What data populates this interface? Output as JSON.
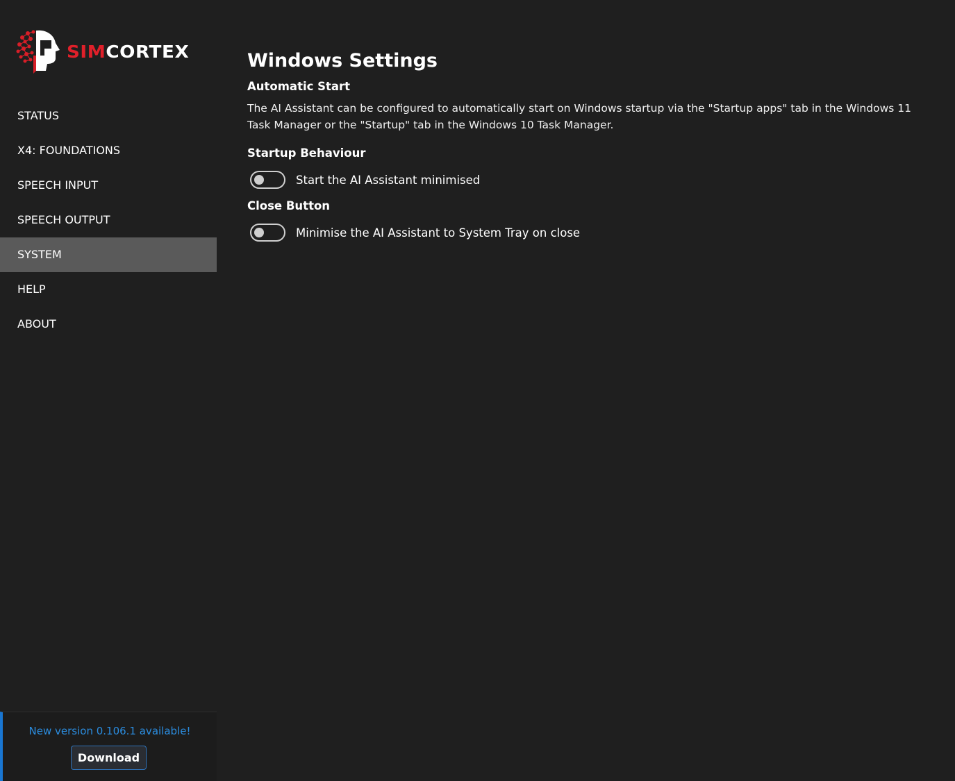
{
  "brand": {
    "part1": "SIM",
    "part2": "CORTEX",
    "accent_color": "#e0202a",
    "icon": "brain-head-logo-icon"
  },
  "sidebar": {
    "items": [
      {
        "label": "STATUS",
        "active": false
      },
      {
        "label": "X4: FOUNDATIONS",
        "active": false
      },
      {
        "label": "SPEECH INPUT",
        "active": false
      },
      {
        "label": "SPEECH OUTPUT",
        "active": false
      },
      {
        "label": "SYSTEM",
        "active": true
      },
      {
        "label": "HELP",
        "active": false
      },
      {
        "label": "ABOUT",
        "active": false
      }
    ],
    "active_color": "#5a5a5a"
  },
  "update": {
    "message": "New version 0.106.1 available!",
    "button_label": "Download",
    "accent_color": "#1976d2"
  },
  "main": {
    "title": "Windows Settings",
    "automatic_start": {
      "heading": "Automatic Start",
      "description": "The AI Assistant can be configured to automatically start on Windows startup via the \"Startup apps\" tab in the Windows 11 Task Manager or the \"Startup\" tab in the Windows 10 Task Manager."
    },
    "startup_behaviour": {
      "heading": "Startup Behaviour",
      "toggle_label": "Start the AI Assistant minimised",
      "toggle_on": false
    },
    "close_button": {
      "heading": "Close Button",
      "toggle_label": "Minimise the AI Assistant to System Tray on close",
      "toggle_on": false
    }
  }
}
